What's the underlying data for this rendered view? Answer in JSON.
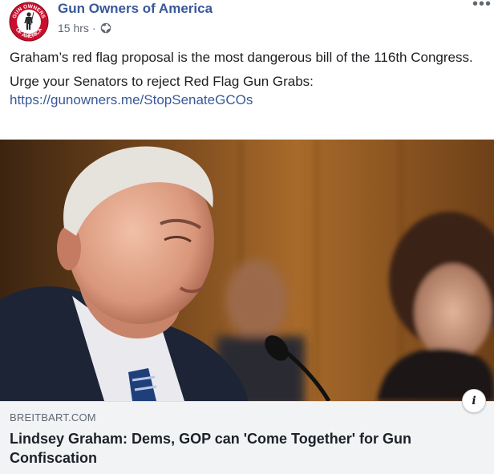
{
  "post": {
    "page_name": "Gun Owners of America",
    "timestamp": "15 hrs",
    "separator": "·",
    "privacy_icon": "globe-icon",
    "more_icon": "more-options-icon",
    "more_glyph": "•••",
    "avatar": {
      "icon": "gun-owners-of-america-logo",
      "seal_text_top": "GUN OWNERS",
      "seal_text_bottom": "OF AMERICA",
      "colors": {
        "ring": "#c8102e",
        "inner": "#ffffff"
      }
    },
    "text_paragraph_1": "Graham’s red flag proposal is the most dangerous bill of the 116th Congress.",
    "text_paragraph_2": "Urge your Senators to reject Red Flag Gun Grabs:",
    "link_url": "https://gunowners.me/StopSenateGCOs"
  },
  "link_preview": {
    "domain": "BREITBART.COM",
    "headline": "Lindsey Graham: Dems, GOP can 'Come Together' for Gun Confiscation",
    "info_glyph": "i",
    "info_icon": "info-icon"
  },
  "colors": {
    "link": "#385898",
    "text": "#1c1e21",
    "muted": "#606770",
    "card_bg": "#f2f3f5"
  }
}
